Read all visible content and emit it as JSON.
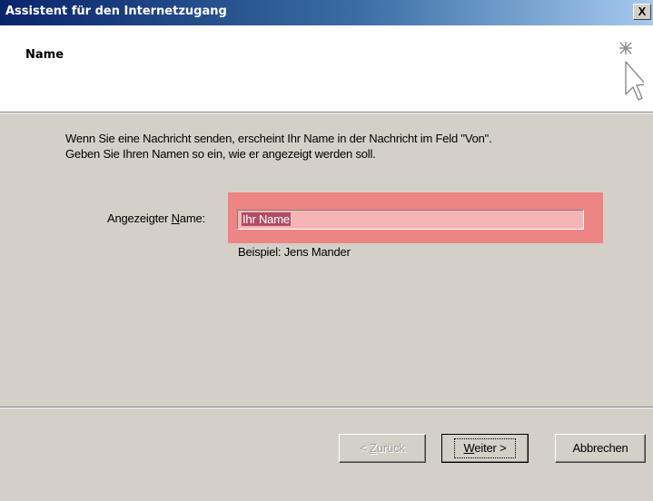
{
  "window": {
    "title": "Assistent für den Internetzugang",
    "close_glyph": "X"
  },
  "header": {
    "heading": "Name",
    "icon": "wizard-cursor-icon"
  },
  "content": {
    "description_line1": "Wenn Sie eine Nachricht senden, erscheint Ihr Name in der Nachricht im Feld \"Von\".",
    "description_line2": "Geben Sie Ihren Namen so ein, wie er angezeigt werden soll.",
    "field_label_pre": "Angezeigter ",
    "field_label_accel": "N",
    "field_label_post": "ame:",
    "field_value": "Ihr Name",
    "example": "Beispiel: Jens Mander",
    "highlight_color": "#f07878"
  },
  "buttons": {
    "back_pre": "< ",
    "back_accel": "Z",
    "back_post": "urück",
    "next_accel": "W",
    "next_post": "eiter >",
    "cancel": "Abbrechen"
  }
}
